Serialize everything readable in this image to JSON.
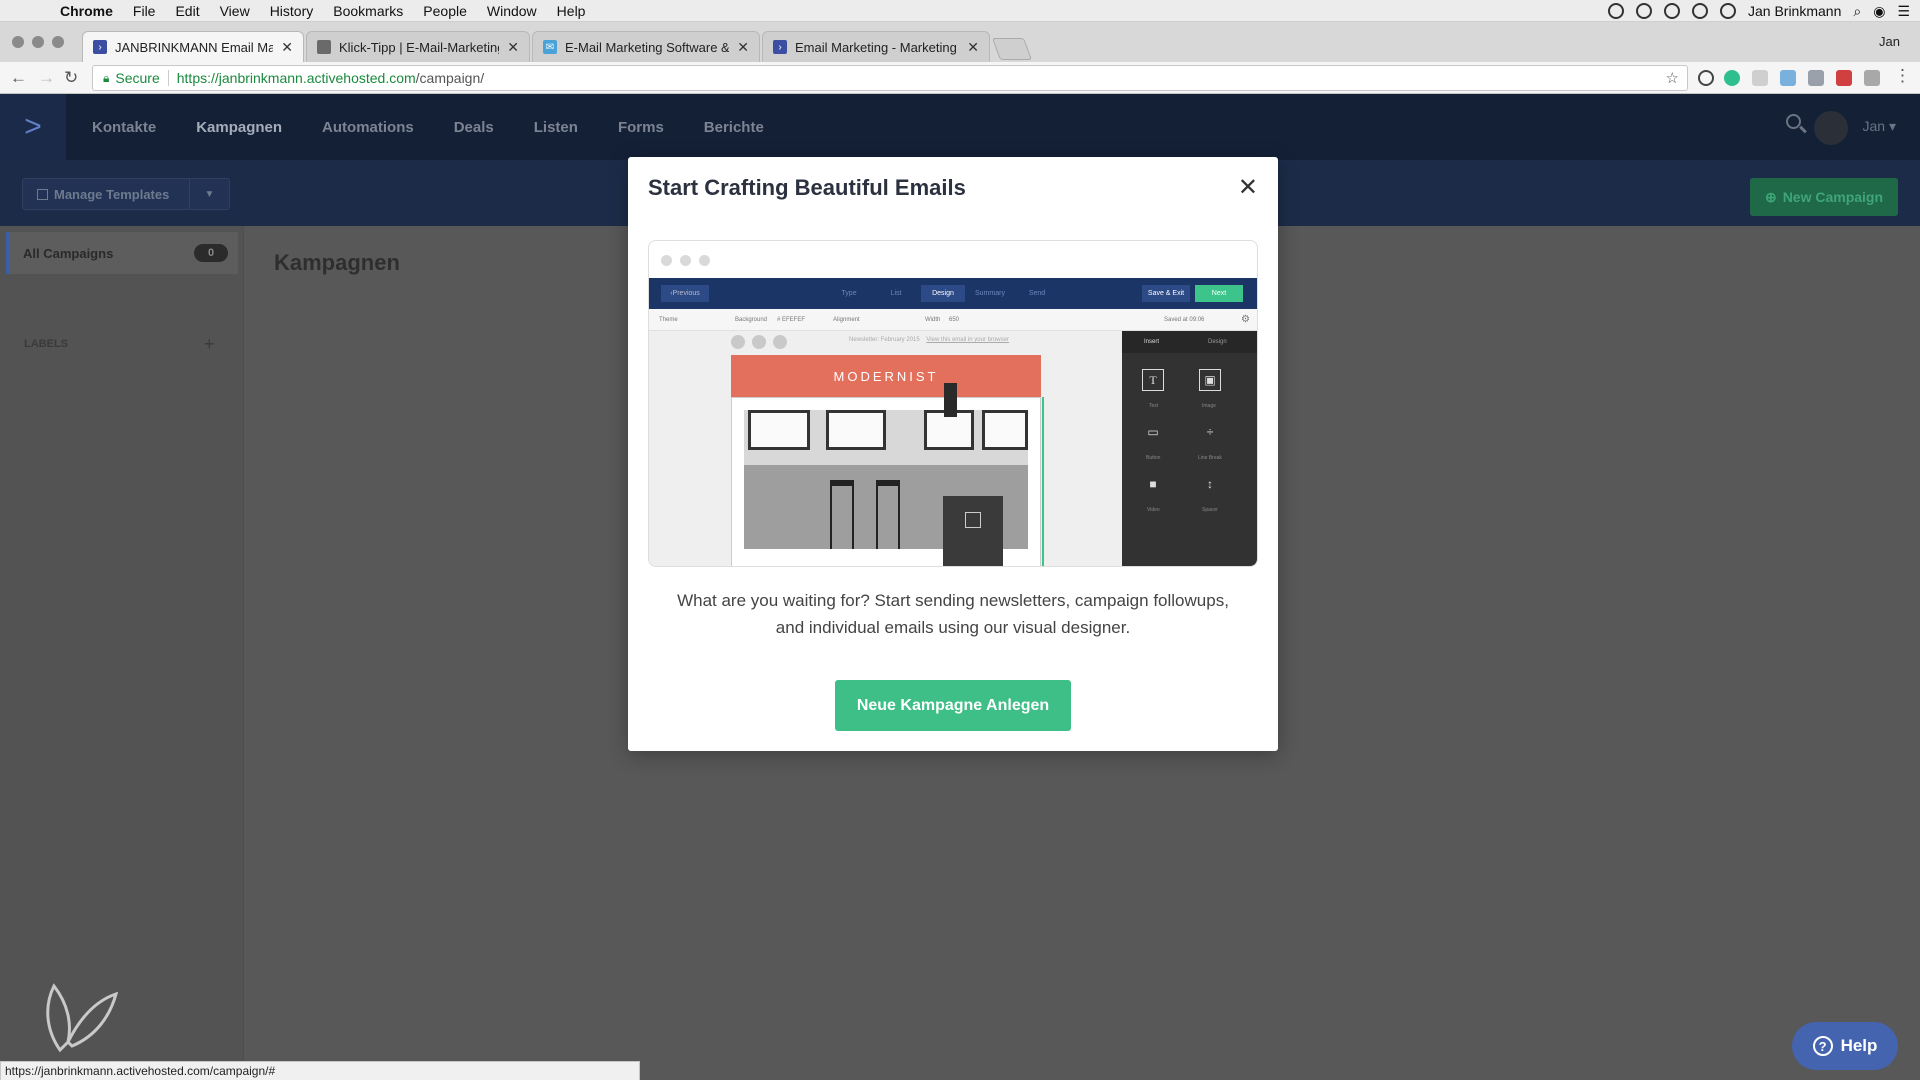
{
  "menubar": {
    "app": "Chrome",
    "items": [
      "File",
      "Edit",
      "View",
      "History",
      "Bookmarks",
      "People",
      "Window",
      "Help"
    ],
    "user": "Jan Brinkmann"
  },
  "browser": {
    "profile": "Jan",
    "tabs": [
      {
        "title": "JANBRINKMANN Email Marke",
        "active": true
      },
      {
        "title": "Klick-Tipp | E-Mail-Marketing",
        "active": false
      },
      {
        "title": "E-Mail Marketing Software &",
        "active": false
      },
      {
        "title": "Email Marketing - Marketing A",
        "active": false
      }
    ],
    "secure_label": "Secure",
    "url_host": "https://janbrinkmann.activehosted.com",
    "url_path": "/campaign/",
    "status_url": "https://janbrinkmann.activehosted.com/campaign/#"
  },
  "nav": {
    "links": [
      "Kontakte",
      "Kampagnen",
      "Automations",
      "Deals",
      "Listen",
      "Forms",
      "Berichte"
    ],
    "active": "Kampagnen",
    "user": "Jan"
  },
  "subbar": {
    "templates_label": "Manage Templates",
    "new_campaign_label": "New Campaign"
  },
  "sidebar": {
    "all_campaigns": "All Campaigns",
    "count": "0",
    "labels_heading": "LABELS",
    "add": "+"
  },
  "page_title": "Kampagnen",
  "modal": {
    "title": "Start Crafting Beautiful Emails",
    "body_line1": "What are you waiting for? Start sending newsletters, campaign followups,",
    "body_line2": "and individual emails using our visual designer.",
    "cta": "Neue Kampagne Anlegen",
    "preview": {
      "prev": "Previous",
      "steps": [
        "Type",
        "List",
        "Design",
        "Summary",
        "Send"
      ],
      "active_step": "Design",
      "save_exit": "Save & Exit",
      "next": "Next",
      "opt_theme": "Theme",
      "opt_background": "Background",
      "opt_bgvalue": "# EFEFEF",
      "opt_alignment": "Alignment",
      "opt_width": "Width",
      "opt_width_value": "650",
      "saved": "Saved at 09:06",
      "newsletter": "Newsletter: February 2015",
      "view_browser": "View this email in your browser",
      "header_text": "MODERNIST",
      "panel_insert": "Insert",
      "panel_design": "Design",
      "tools": [
        "Text",
        "Image",
        "Button",
        "Line Break",
        "Video",
        "Spacer"
      ]
    }
  },
  "help_label": "Help"
}
